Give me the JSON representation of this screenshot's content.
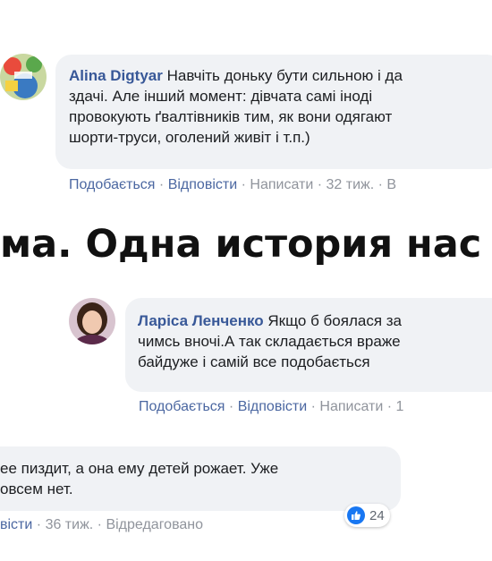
{
  "comment1": {
    "author": "Alina Digtyar",
    "lines": [
      "Навчіть доньку бути сильною і да",
      "здачі. Але інший момент: дівчата самі іноді",
      "провокують ґвалтівників тим, як вони одягают",
      "шорти-труси, оголений живіт і т.п.)"
    ],
    "actions": {
      "like": "Подобається",
      "reply": "Відповісти",
      "write": "Написати",
      "time": "32 тиж.",
      "more": "В"
    }
  },
  "headline": "ма. Одна история нас",
  "comment2": {
    "author": "Ларіса Ленченко",
    "lines": [
      "Якщо б боялася за",
      "чимсь вночі.А так складається враже",
      "байдуже і самій все подобається"
    ],
    "actions": {
      "like": "Подобається",
      "reply": "Відповісти",
      "write": "Написати",
      "time": "1"
    }
  },
  "comment3": {
    "lines": [
      "ее пиздит, а она ему детей рожает. Уже",
      "овсем нет."
    ],
    "actions": {
      "reply": "вісти",
      "time": "36 тиж.",
      "edited": "Відредаговано"
    },
    "reactions": {
      "icon": "like-icon",
      "count": "24"
    }
  },
  "colors": {
    "author": "#385898",
    "bubble": "#f0f2f5",
    "link": "#4b67a1",
    "meta": "#90949c",
    "like": "#1877f2"
  }
}
